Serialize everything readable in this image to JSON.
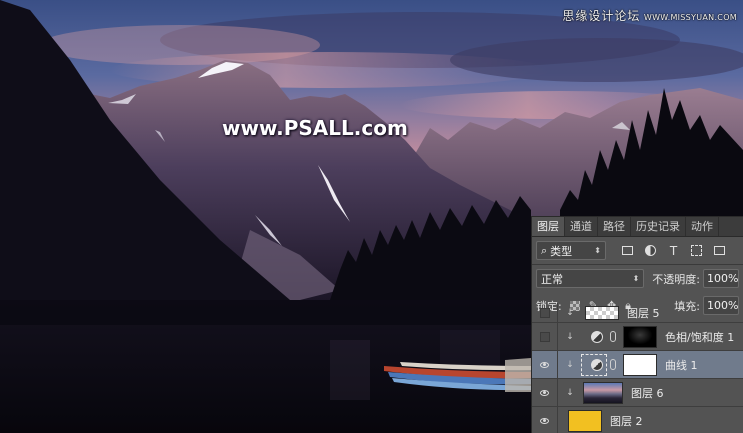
{
  "watermark": {
    "top_cn": "思缘设计论坛",
    "top_en": "WWW.MISSYUAN.COM",
    "center": "www.PSALL.com"
  },
  "panel": {
    "tabs": [
      {
        "label": "图层",
        "active": true
      },
      {
        "label": "通道",
        "active": false
      },
      {
        "label": "路径",
        "active": false
      },
      {
        "label": "历史记录",
        "active": false
      },
      {
        "label": "动作",
        "active": false
      }
    ],
    "filter": {
      "icon": "search-icon",
      "value": "类型"
    },
    "blend_mode": "正常",
    "opacity_label": "不透明度:",
    "opacity_value": "100%",
    "lock_label": "锁定:",
    "fill_label": "填充:",
    "fill_value": "100%",
    "layers": [
      {
        "name": "图层 5",
        "visible": false,
        "clipped": true,
        "thumbnail": "transparent"
      },
      {
        "name": "色相/饱和度 1",
        "visible": false,
        "clipped": true,
        "thumbnail": "black-mask",
        "adjustment": true
      },
      {
        "name": "曲线 1",
        "visible": true,
        "clipped": true,
        "thumbnail": "white-mask",
        "adjustment": true,
        "selected": true
      },
      {
        "name": "图层 6",
        "visible": true,
        "clipped": true,
        "thumbnail": "photo"
      },
      {
        "name": "图层 2",
        "visible": true,
        "clipped": false,
        "thumbnail": "yellow"
      }
    ]
  }
}
